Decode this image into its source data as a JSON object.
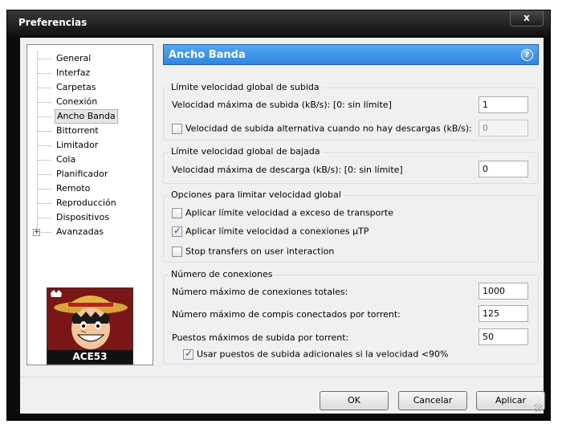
{
  "window": {
    "title": "Preferencias",
    "close_glyph": "x"
  },
  "nav": {
    "items": [
      {
        "label": "General"
      },
      {
        "label": "Interfaz"
      },
      {
        "label": "Carpetas"
      },
      {
        "label": "Conexión"
      },
      {
        "label": "Ancho Banda",
        "selected": true
      },
      {
        "label": "Bittorrent"
      },
      {
        "label": "Limitador"
      },
      {
        "label": "Cola"
      },
      {
        "label": "Planificador"
      },
      {
        "label": "Remoto"
      },
      {
        "label": "Reproducción"
      },
      {
        "label": "Dispositivos"
      },
      {
        "label": "Avanzadas",
        "expandable": true
      }
    ],
    "expander_glyph": "+",
    "avatar_label": "ACE53"
  },
  "header": {
    "title": "Ancho Banda",
    "help_glyph": "?"
  },
  "upload": {
    "title": "Límite velocidad global de subida",
    "max_label": "Velocidad máxima de subida (kB/s): [0: sin límite]",
    "max_value": "1",
    "alt_label": "Velocidad de subida alternativa cuando no hay descargas (kB/s):",
    "alt_checked": false,
    "alt_value": "0"
  },
  "download": {
    "title": "Límite velocidad global de bajada",
    "max_label": "Velocidad máxima de descarga (kB/s): [0: sin límite]",
    "max_value": "0"
  },
  "options": {
    "title": "Opciones para limitar velocidad global",
    "transport_label": "Aplicar límite velocidad a exceso de transporte",
    "transport_checked": false,
    "utp_label": "Aplicar límite velocidad a conexiones µTP",
    "utp_checked": true,
    "stop_label": "Stop transfers on user interaction",
    "stop_checked": false
  },
  "connections": {
    "title": "Número de conexiones",
    "total_label": "Número máximo de conexiones totales:",
    "total_value": "1000",
    "peers_label": "Número máximo de compis conectados por torrent:",
    "peers_value": "125",
    "slots_label": "Puestos máximos de subida por torrent:",
    "slots_value": "50",
    "extra_label": "Usar puestos de subida adicionales si la velocidad <90%",
    "extra_checked": true
  },
  "buttons": {
    "ok": "OK",
    "cancel": "Cancelar",
    "apply": "Aplicar"
  },
  "colors": {
    "header_blue": "#3d94e8",
    "avatar_red": "#7a1616"
  }
}
